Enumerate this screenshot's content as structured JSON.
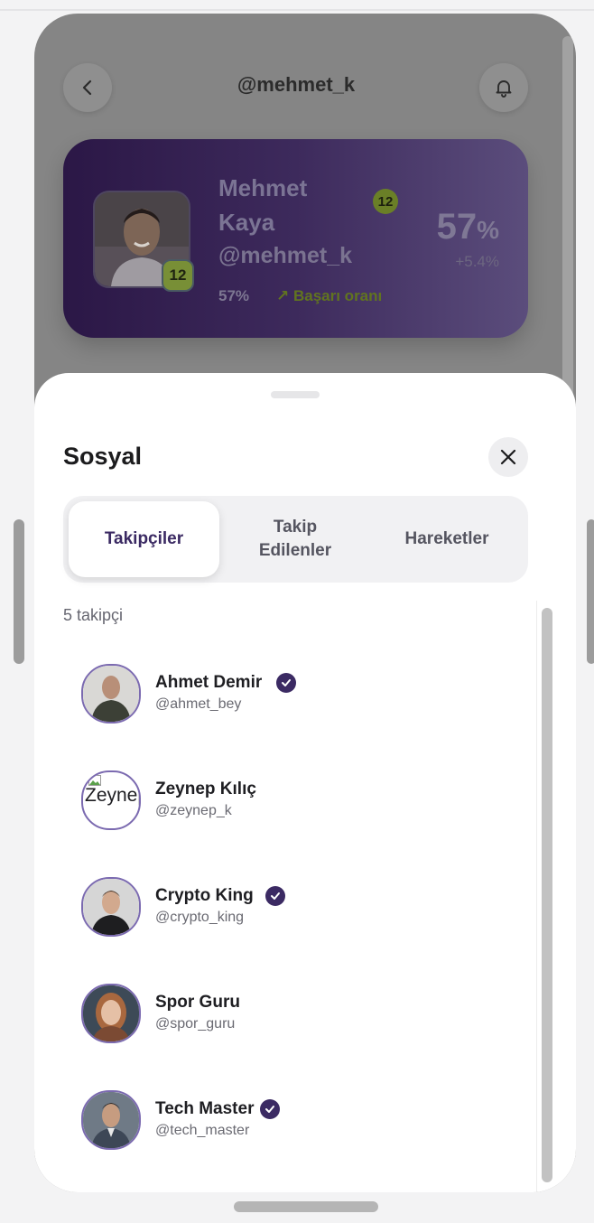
{
  "header": {
    "title": "@mehmet_k",
    "back_icon": "chevron-left-icon",
    "bell_icon": "bell-icon"
  },
  "profile": {
    "name": "Mehmet Kaya",
    "handle": "@mehmet_k",
    "level": "12",
    "success_rate_value": "57%",
    "success_rate_label": "Başarı oranı",
    "success_rate_big": "57",
    "success_rate_unit": "%",
    "rate_change": "+5.4%"
  },
  "sheet": {
    "title": "Sosyal",
    "close_icon": "close-icon",
    "tabs": [
      {
        "label": "Takipçiler",
        "active": true
      },
      {
        "label": "Takip Edilenler",
        "active": false
      },
      {
        "label": "Hareketler",
        "active": false
      }
    ],
    "count_label": "5 takipçi",
    "followers": [
      {
        "name": "Ahmet Demir",
        "handle": "@ahmet_bey",
        "verified": true
      },
      {
        "name": "Zeynep Kılıç",
        "handle": "@zeynep_k",
        "verified": false,
        "avatar_alt": "Zeynep"
      },
      {
        "name": "Crypto King",
        "handle": "@crypto_king",
        "verified": true
      },
      {
        "name": "Spor Guru",
        "handle": "@spor_guru",
        "verified": false
      },
      {
        "name": "Tech Master",
        "handle": "@tech_master",
        "verified": true
      }
    ]
  },
  "colors": {
    "accent": "#3b2a63",
    "lime": "#6a7f27",
    "overlay": "#858585"
  }
}
